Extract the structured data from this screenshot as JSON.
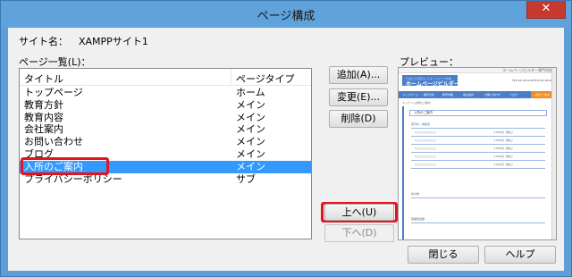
{
  "window": {
    "title": "ページ構成",
    "close_glyph": "✕"
  },
  "site": {
    "label": "サイト名：",
    "name": "XAMPPサイト1"
  },
  "page_list": {
    "label": "ページ一覧(L)：",
    "columns": [
      "タイトル",
      "ページタイプ"
    ],
    "rows": [
      {
        "title": "トップページ",
        "type": "ホーム"
      },
      {
        "title": "教育方針",
        "type": "メイン"
      },
      {
        "title": "教育内容",
        "type": "メイン"
      },
      {
        "title": "会社案内",
        "type": "メイン"
      },
      {
        "title": "お問い合わせ",
        "type": "メイン"
      },
      {
        "title": "ブログ",
        "type": "メイン"
      },
      {
        "title": "入所のご案内",
        "type": "メイン"
      },
      {
        "title": "プライバシーポリシー",
        "type": "サブ"
      }
    ],
    "selected_index": 6
  },
  "buttons": {
    "add": "追加(A)...",
    "change": "変更(E)...",
    "delete": "削除(D)",
    "up": "上へ(U)",
    "down": "下へ(D)",
    "close": "閉じる",
    "help": "ヘルプ"
  },
  "preview": {
    "label": "プレビュー：",
    "site_topright": "ホームページビルダー専門学校",
    "logo_tagline": "どなたでも安心してホームページ作成",
    "logo_title": "ホームページビルダー専門学校",
    "tel": "TEL 03-1234-5678  9:00-18:00",
    "nav": [
      "トップページ",
      "教育方針",
      "教育内容",
      "会社案内",
      "お問い合わせ",
      "ブログ",
      "入所のご案内"
    ],
    "breadcrumb": "トップ > 入所のご案内",
    "heading": "入所のご案内",
    "subheading": "保育料・諸費用",
    "table_rows": [
      "○○○○○○○○○",
      "○○○○○○○○○",
      "○○○○○○○○○",
      "○○○○○○○○○",
      "○○○○○○○○○"
    ],
    "table_prices": [
      "3,000円（税込）",
      "3,000円（税込）",
      "3,000円（税込）",
      "3,000円（税込）",
      "3,000円（税込）"
    ],
    "section2": "持ち物",
    "section3": "保護者会費"
  },
  "colors": {
    "selection": "#3399ff",
    "highlight": "#e5141c",
    "titlebar": "#5fa2dc",
    "preview_accent": "#4a7ec9",
    "preview_active_nav": "#f28c1e"
  }
}
